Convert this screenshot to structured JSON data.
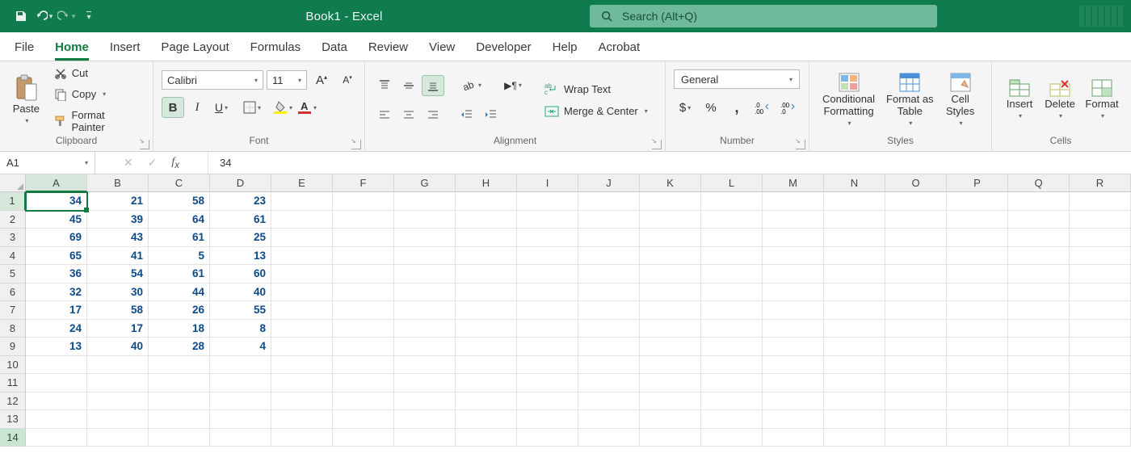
{
  "title": "Book1  -  Excel",
  "search_placeholder": "Search (Alt+Q)",
  "tabs": [
    "File",
    "Home",
    "Insert",
    "Page Layout",
    "Formulas",
    "Data",
    "Review",
    "View",
    "Developer",
    "Help",
    "Acrobat"
  ],
  "active_tab": "Home",
  "ribbon": {
    "clipboard": {
      "label": "Clipboard",
      "paste": "Paste",
      "cut": "Cut",
      "copy": "Copy",
      "format_painter": "Format Painter"
    },
    "font": {
      "label": "Font",
      "name": "Calibri",
      "size": "11"
    },
    "alignment": {
      "label": "Alignment",
      "wrap": "Wrap Text",
      "merge": "Merge & Center"
    },
    "number": {
      "label": "Number",
      "format": "General"
    },
    "styles": {
      "label": "Styles",
      "cond": "Conditional\nFormatting",
      "table": "Format as\nTable",
      "cell": "Cell\nStyles"
    },
    "cells": {
      "label": "Cells",
      "insert": "Insert",
      "delete": "Delete",
      "format": "Format"
    }
  },
  "namebox": "A1",
  "formula": "34",
  "columns": [
    "A",
    "B",
    "C",
    "D",
    "E",
    "F",
    "G",
    "H",
    "I",
    "J",
    "K",
    "L",
    "M",
    "N",
    "O",
    "P",
    "Q",
    "R"
  ],
  "total_rows": 14,
  "active_cell": {
    "row": 1,
    "col": "A"
  },
  "chart_data": {
    "type": "table",
    "columns": [
      "A",
      "B",
      "C",
      "D"
    ],
    "rows": [
      [
        34,
        21,
        58,
        23
      ],
      [
        45,
        39,
        64,
        61
      ],
      [
        69,
        43,
        61,
        25
      ],
      [
        65,
        41,
        5,
        13
      ],
      [
        36,
        54,
        61,
        60
      ],
      [
        32,
        30,
        44,
        40
      ],
      [
        17,
        58,
        26,
        55
      ],
      [
        24,
        17,
        18,
        8
      ],
      [
        13,
        40,
        28,
        4
      ]
    ]
  }
}
